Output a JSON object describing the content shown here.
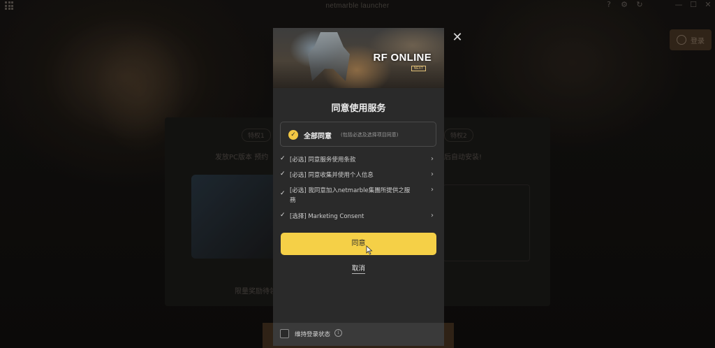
{
  "window": {
    "app_title": "netmarble launcher",
    "help_icon": "help-circle-icon",
    "settings_icon": "gear-icon",
    "refresh_icon": "refresh-icon",
    "minimize_icon": "minimize-icon",
    "maximize_icon": "maximize-icon",
    "close_icon": "close-icon",
    "login_label": "登录"
  },
  "background": {
    "promo_tag_left": "特权1",
    "promo_tag_right": "特权2",
    "promo_text_left": "发放PC版本 预约",
    "promo_text_right": "后自动安装!",
    "promo_footer_text": "限量奖励待领取"
  },
  "modal": {
    "banner_logo": "RF ONLINE",
    "banner_logo_sub": "NEXT",
    "title": "同意使用服务",
    "agree_all": {
      "label": "全部同意",
      "note": "(包括必选及选择项目同意)",
      "checked": true
    },
    "terms": [
      {
        "label": "[必选] 同意服务使用条款",
        "checked": true
      },
      {
        "label": "[必选] 同意收集并使用个人信息",
        "checked": true
      },
      {
        "label": "[必选] 我同意加入netmarble集團所提供之服務",
        "checked": true
      },
      {
        "label": "[选择] Marketing Consent",
        "checked": true
      }
    ],
    "agree_button": "同意",
    "cancel_link": "取消",
    "keep_login_label": "维持登录状态",
    "keep_login_checked": false
  },
  "colors": {
    "accent": "#f5d047",
    "modal_bg": "#2a2a2a",
    "footer_bg": "#3a3a3a"
  }
}
